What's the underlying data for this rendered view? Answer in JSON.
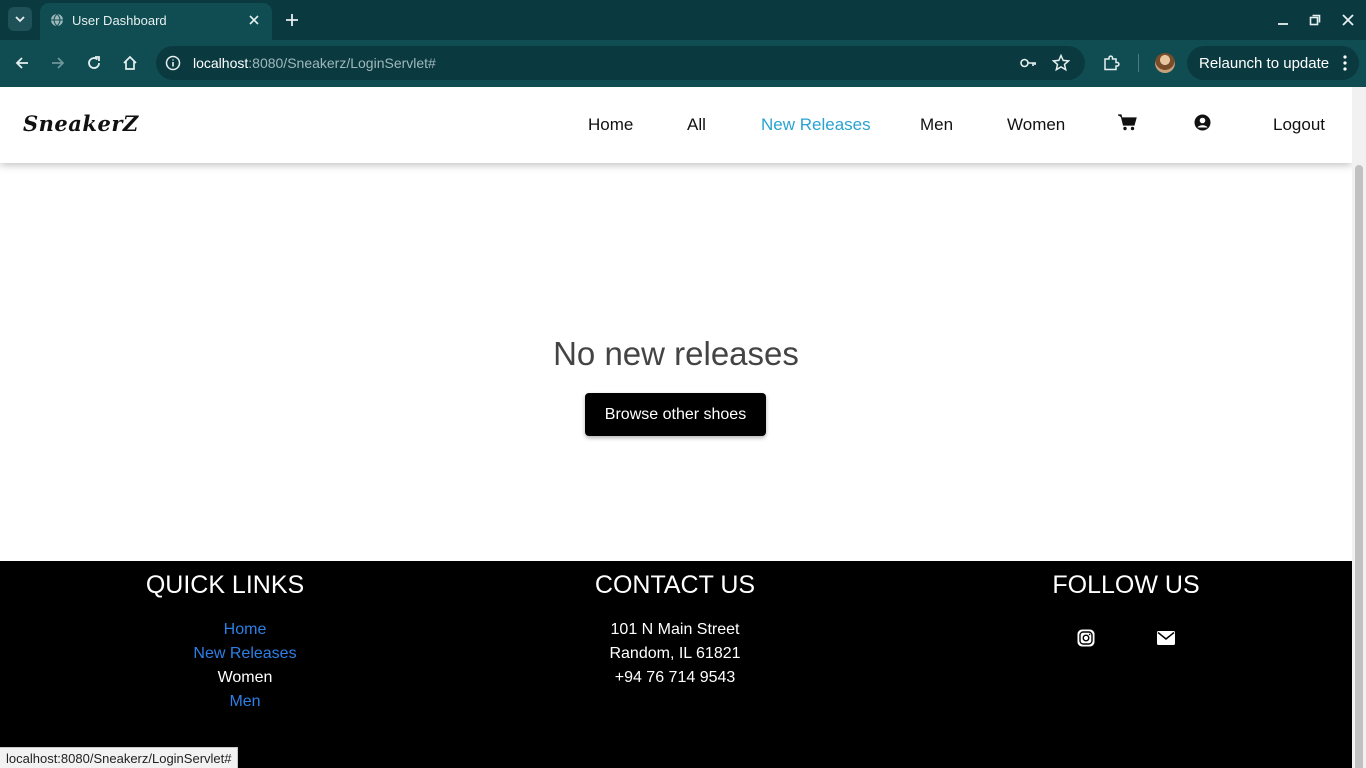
{
  "browser": {
    "tab_title": "User Dashboard",
    "url_host": "localhost",
    "url_rest": ":8080/Sneakerz/LoginServlet#",
    "relaunch_label": "Relaunch to update",
    "status_url": "localhost:8080/Sneakerz/LoginServlet#"
  },
  "site": {
    "logo": "SneakerZ",
    "nav": {
      "home": "Home",
      "all": "All",
      "new_releases": "New Releases",
      "men": "Men",
      "women": "Women",
      "logout": "Logout"
    },
    "active_nav_color": "#2aa3d0"
  },
  "main": {
    "empty_message": "No new releases",
    "browse_button": "Browse other shoes"
  },
  "footer": {
    "quick_links_title": "QUICK LINKS",
    "quick_links": [
      "Home",
      "New Releases",
      "Women",
      "Men"
    ],
    "contact_title": "CONTACT US",
    "contact_lines": [
      "101 N Main Street",
      "Random, IL 61821",
      "+94 76 714 9543"
    ],
    "follow_title": "FOLLOW US",
    "social_icons": [
      "instagram-icon",
      "mail-icon"
    ]
  }
}
